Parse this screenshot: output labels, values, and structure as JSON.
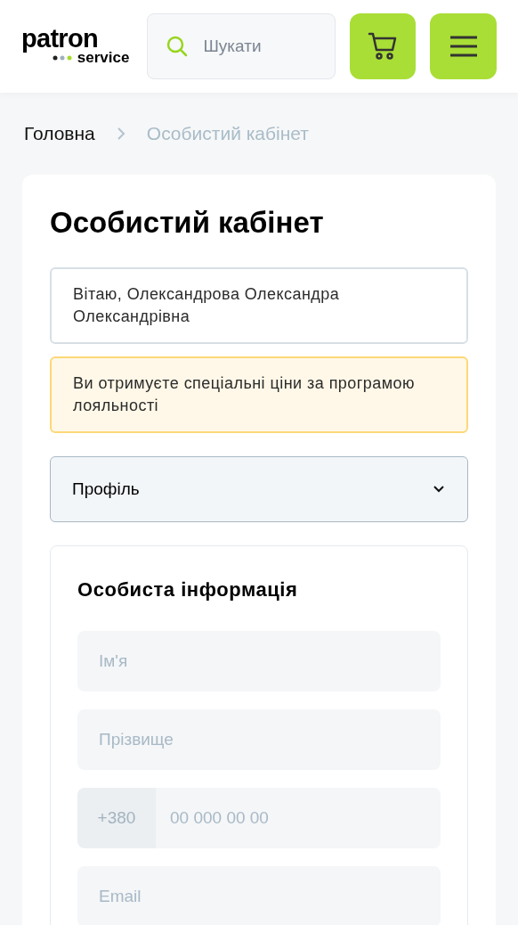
{
  "header": {
    "logo": {
      "word": "patron",
      "sub": "service"
    },
    "search": {
      "placeholder": "Шукати"
    }
  },
  "breadcrumbs": [
    {
      "label": "Головна",
      "current": false
    },
    {
      "label": "Особистий кабінет",
      "current": true
    }
  ],
  "page_title": "Особистий кабінет",
  "greeting": "Вітаю, Олександрова Олександра Олександрівна",
  "loyalty_notice": "Ви отримуєте спеціальні ціни за програмою лояльності",
  "section_select": {
    "value": "Профіль"
  },
  "personal_info": {
    "title": "Особиста інформація",
    "fields": [
      {
        "kind": "text",
        "placeholder": "Ім'я"
      },
      {
        "kind": "text",
        "placeholder": "Прізвище"
      },
      {
        "kind": "phone",
        "prefix": "+380",
        "placeholder": "00 000 00 00"
      },
      {
        "kind": "text",
        "placeholder": "Email"
      }
    ]
  }
}
